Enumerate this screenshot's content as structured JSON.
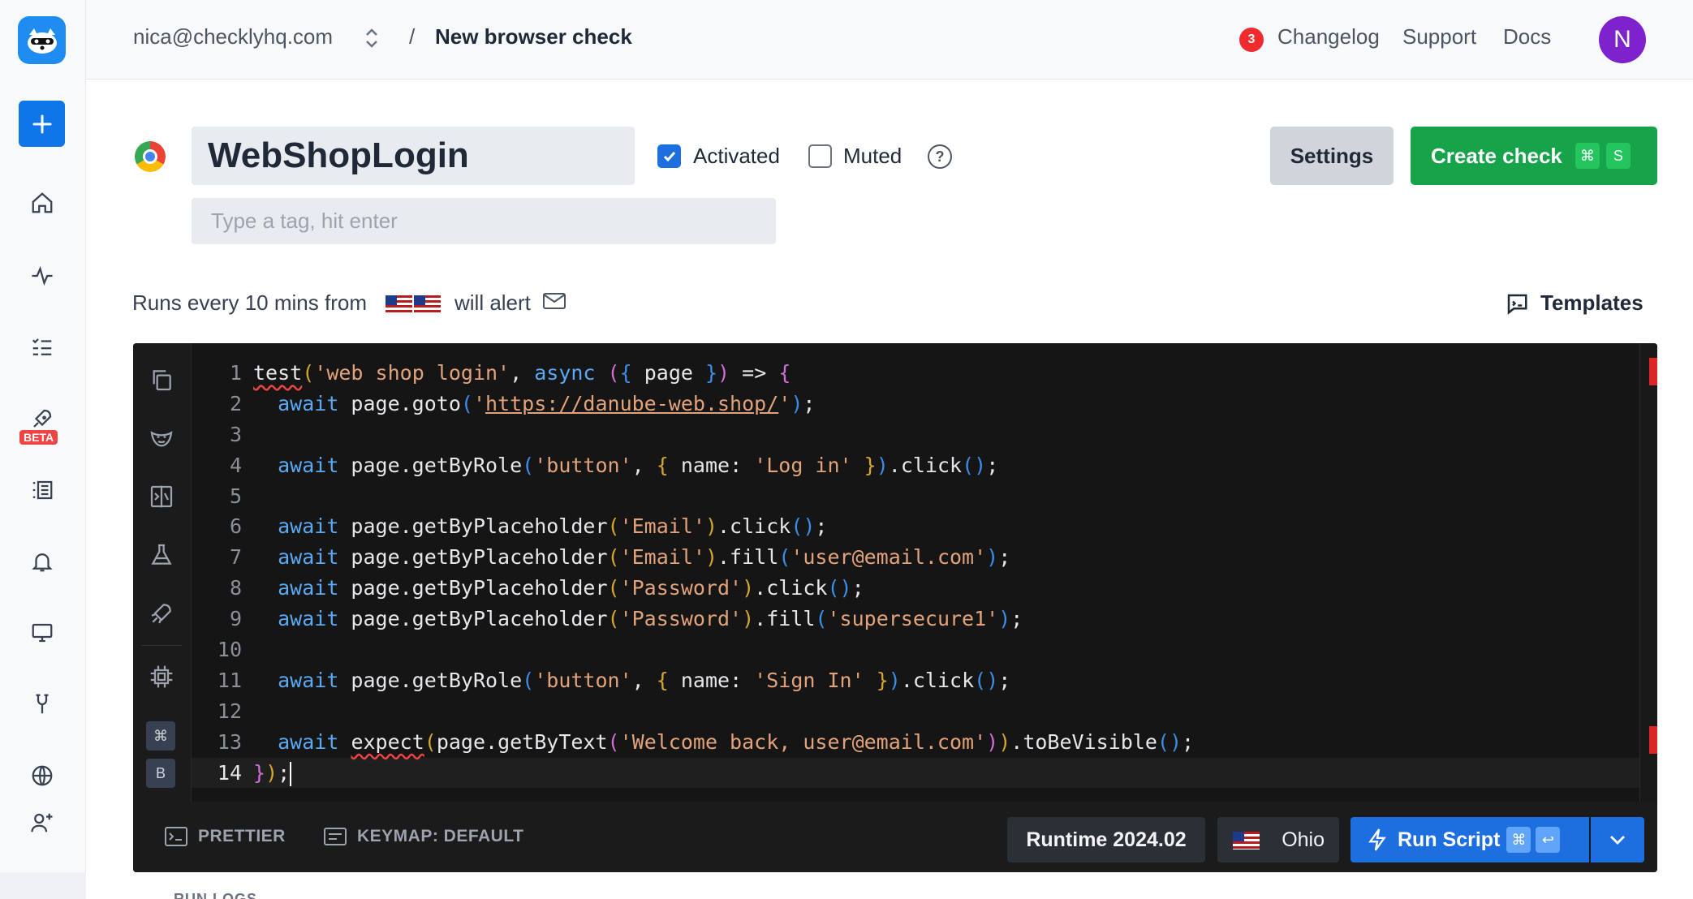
{
  "topbar": {
    "account": "nica@checklyhq.com",
    "breadcrumb_sep": "/",
    "page_title": "New browser check",
    "changelog_count": "3",
    "changelog": "Changelog",
    "support": "Support",
    "docs": "Docs",
    "avatar_initial": "N"
  },
  "sidebar": {
    "beta_badge": "BETA",
    "items": [
      "home",
      "activity",
      "checklist",
      "rocket",
      "list",
      "alerts",
      "dashboard",
      "integrations",
      "globe",
      "add-user"
    ]
  },
  "check": {
    "name": "WebShopLogin",
    "tag_placeholder": "Type a tag, hit enter",
    "activated_label": "Activated",
    "activated": true,
    "muted_label": "Muted",
    "muted": false,
    "help": "?",
    "settings_label": "Settings",
    "create_label": "Create check",
    "create_kbd": [
      "⌘",
      "S"
    ]
  },
  "schedule": {
    "runs_text": "Runs every 10 mins from",
    "alert_text": "will alert",
    "templates_label": "Templates"
  },
  "editor": {
    "kbd_keys": [
      "⌘",
      "B"
    ],
    "lines": [
      {
        "n": "1"
      },
      {
        "n": "2"
      },
      {
        "n": "3"
      },
      {
        "n": "4"
      },
      {
        "n": "5"
      },
      {
        "n": "6"
      },
      {
        "n": "7"
      },
      {
        "n": "8"
      },
      {
        "n": "9"
      },
      {
        "n": "10"
      },
      {
        "n": "11"
      },
      {
        "n": "12"
      },
      {
        "n": "13"
      },
      {
        "n": "14"
      }
    ],
    "code_text": [
      "test('web shop login', async ({ page }) => {",
      "  await page.goto('https://danube-web.shop/');",
      "",
      "  await page.getByRole('button', { name: 'Log in' }).click();",
      "",
      "  await page.getByPlaceholder('Email').click();",
      "  await page.getByPlaceholder('Email').fill('user@email.com');",
      "  await page.getByPlaceholder('Password').click();",
      "  await page.getByPlaceholder('Password').fill('supersecure1');",
      "",
      "  await page.getByRole('button', { name: 'Sign In' }).click();",
      "",
      "  await expect(page.getByText('Welcome back, user@email.com')).toBeVisible();",
      "});"
    ],
    "prettier_label": "PRETTIER",
    "keymap_label": "KEYMAP: DEFAULT",
    "runtime_label": "Runtime 2024.02",
    "location_label": "Ohio",
    "run_label": "Run Script",
    "run_kbd": [
      "⌘",
      "↩"
    ]
  },
  "below": {
    "run_logs": "RUN LOGS"
  },
  "colors": {
    "primary": "#1d6fe0",
    "success": "#16a34a",
    "avatar": "#7e22ce",
    "editor_bg": "#151515"
  }
}
